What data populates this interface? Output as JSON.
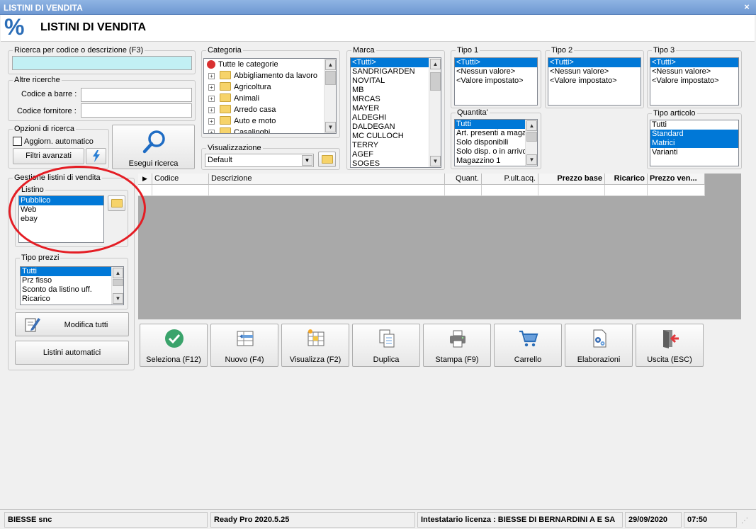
{
  "window": {
    "title": "LISTINI DI VENDITA",
    "close_label": "×"
  },
  "header": {
    "icon_glyph": "%",
    "title": "LISTINI DI VENDITA"
  },
  "search": {
    "legend": "Ricerca per codice o descrizione (F3)",
    "value": ""
  },
  "altre": {
    "legend": "Altre ricerche",
    "barcode_label": "Codice a barre :",
    "supplier_label": "Codice fornitore :",
    "barcode_value": "",
    "supplier_value": ""
  },
  "opzioni": {
    "legend": "Opzioni di ricerca",
    "auto_update_label": "Aggiorn. automatico",
    "advanced_filters_label": "Filtri avanzati",
    "run_search_label": "Esegui ricerca"
  },
  "categoria": {
    "legend": "Categoria",
    "root": "Tutte le categorie",
    "items": [
      "Abbigliamento da lavoro",
      "Agricoltura",
      "Animali",
      "Arredo casa",
      "Auto e moto",
      "Casalinghi"
    ]
  },
  "visualizzazione": {
    "legend": "Visualizzazione",
    "selected": "Default"
  },
  "marca": {
    "legend": "Marca",
    "items": [
      "<Tutti>",
      "SANDRIGARDEN",
      "NOVITAL",
      "MB",
      "MRCAS",
      "MAYER",
      "ALDEGHI",
      "DALDEGAN",
      "MC CULLOCH",
      "TERRY",
      "AGEF",
      "SOGES"
    ]
  },
  "tipo1": {
    "legend": "Tipo 1",
    "items": [
      "<Tutti>",
      "<Nessun valore>",
      "<Valore impostato>"
    ]
  },
  "tipo2": {
    "legend": "Tipo 2",
    "items": [
      "<Tutti>",
      "<Nessun valore>",
      "<Valore impostato>"
    ]
  },
  "tipo3": {
    "legend": "Tipo 3",
    "items": [
      "<Tutti>",
      "<Nessun valore>",
      "<Valore impostato>"
    ]
  },
  "quantita": {
    "legend": "Quantita'",
    "items": [
      "Tutti",
      "Art. presenti a magazzino",
      "Solo disponibili",
      "Solo disp. o in arrivo",
      "Magazzino 1"
    ]
  },
  "tipo_articolo": {
    "legend": "Tipo articolo",
    "items": [
      "Tutti",
      "Standard",
      "Matrici",
      "Varianti"
    ]
  },
  "gestione": {
    "legend": "Gestione listini di vendita",
    "listino_legend": "Listino",
    "listino_items": [
      "Pubblico",
      "Web",
      "ebay"
    ],
    "tipo_prezzi_legend": "Tipo prezzi",
    "tipo_prezzi_items": [
      "Tutti",
      "Prz fisso",
      "Sconto da listino uff.",
      "Ricarico"
    ],
    "modifica_tutti_label": "Modifica tutti",
    "listini_automatici_label": "Listini automatici"
  },
  "grid": {
    "row_indicator": "▶",
    "columns": [
      "Codice",
      "Descrizione",
      "Quant.",
      "P.ult.acq.",
      "Prezzo base",
      "Ricarico",
      "Prezzo ven..."
    ]
  },
  "toolbar": [
    {
      "label": "Seleziona (F12)",
      "icon": "check-circle-icon"
    },
    {
      "label": "Nuovo (F4)",
      "icon": "new-row-icon"
    },
    {
      "label": "Visualizza (F2)",
      "icon": "view-grid-icon"
    },
    {
      "label": "Duplica",
      "icon": "duplicate-icon"
    },
    {
      "label": "Stampa (F9)",
      "icon": "printer-icon"
    },
    {
      "label": "Carrello",
      "icon": "cart-icon"
    },
    {
      "label": "Elaborazioni",
      "icon": "gear-document-icon"
    },
    {
      "label": "Uscita (ESC)",
      "icon": "exit-door-icon"
    }
  ],
  "status": {
    "company": "BIESSE snc",
    "version": "Ready Pro 2020.5.25",
    "license": "Intestatario licenza : BIESSE DI BERNARDINI A E SA",
    "date": "29/09/2020",
    "time": "07:50"
  },
  "colors": {
    "selection": "#0078d7",
    "accent_blue": "#2a6db7",
    "annotation_red": "#e41d24",
    "grid_background": "#a9a9a9",
    "search_field": "#c2f0f4"
  }
}
